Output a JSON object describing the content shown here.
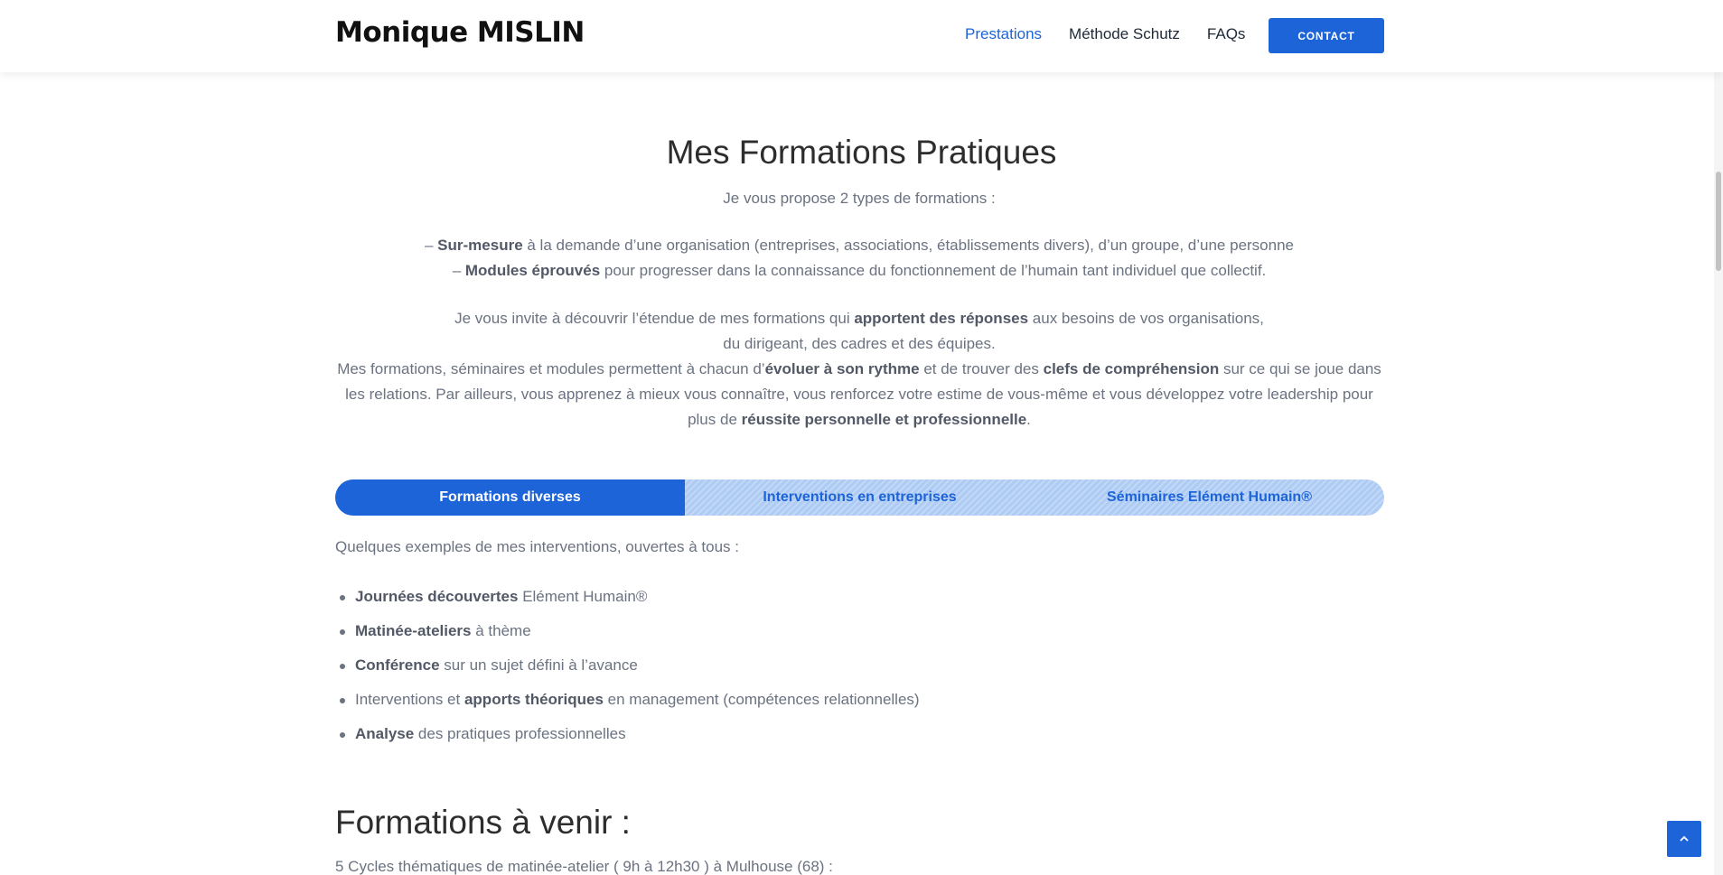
{
  "header": {
    "logo": "Monique MISLIN",
    "nav": [
      {
        "label": "Prestations",
        "active": true
      },
      {
        "label": "Méthode Schutz",
        "active": false
      },
      {
        "label": "FAQs",
        "active": false
      }
    ],
    "contact_label": "CONTACT"
  },
  "intro": {
    "title": "Mes Formations Pratiques",
    "lead": "Je vous propose 2 types de formations :",
    "types": [
      {
        "prefix": "– ",
        "bold": "Sur-mesure",
        "rest": " à la demande d’une organisation (entreprises, associations, établissements divers), d’un groupe, d’une personne"
      },
      {
        "prefix": "– ",
        "bold": "Modules éprouvés",
        "rest": " pour progresser dans la connaissance du fonctionnement de l’humain tant individuel que collectif."
      }
    ],
    "para1": {
      "before": "Je vous invite à découvrir l’étendue de mes formations qui ",
      "bold": "apportent des réponses",
      "after": " aux besoins de vos organisations,",
      "line2": "du dirigeant, des cadres et des équipes."
    },
    "para2": {
      "t1": "Mes formations, séminaires et modules permettent à chacun d’",
      "b1": "évoluer à son rythme",
      "t2": " et de trouver des ",
      "b2": "clefs de compréhension",
      "t3": " sur ce qui se joue dans les relations. Par ailleurs, vous apprenez à mieux vous connaître, vous renforcez votre estime de vous-même et vous développez votre leadership pour plus de ",
      "b3": "réussite personnelle et professionnelle",
      "t4": "."
    }
  },
  "tabs": [
    {
      "label": "Formations diverses",
      "active": true
    },
    {
      "label": "Interventions en entreprises",
      "active": false
    },
    {
      "label": "Séminaires Elément Humain®",
      "active": false
    }
  ],
  "examples": {
    "lead": "Quelques exemples de mes interventions, ouvertes à tous :",
    "items": [
      {
        "pre": "",
        "bold": "Journées découvertes",
        "rest": " Elément Humain®"
      },
      {
        "pre": "",
        "bold": "Matinée-ateliers",
        "rest": " à thème"
      },
      {
        "pre": "",
        "bold": "Conférence",
        "rest": " sur un sujet défini à l’avance"
      },
      {
        "pre": "Interventions et ",
        "bold": "apports théoriques",
        "rest": " en management (compétences relationnelles)"
      },
      {
        "pre": "",
        "bold": "Analyse",
        "rest": " des pratiques professionnelles"
      }
    ]
  },
  "upcoming": {
    "title": "Formations à venir :",
    "text": "5 Cycles thématiques de matinée-atelier ( 9h à 12h30 ) à Mulhouse (68) :"
  },
  "icons": {
    "back_to_top": "chevron-up-icon"
  },
  "colors": {
    "accent": "#1d64d8",
    "tab_inactive_bg": "#aecbf3",
    "heading": "#2d2d2d",
    "body_text": "#6b7280"
  }
}
